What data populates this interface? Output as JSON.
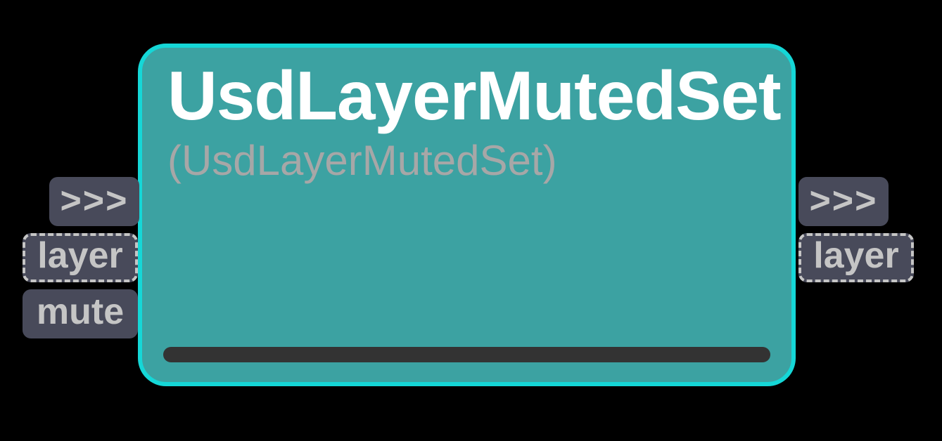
{
  "node": {
    "title": "UsdLayerMutedSet",
    "type": "(UsdLayerMutedSet)",
    "inputs": {
      "flow": ">>>",
      "layer": "layer",
      "mute": "mute"
    },
    "outputs": {
      "flow": ">>>",
      "layer": "layer"
    }
  }
}
